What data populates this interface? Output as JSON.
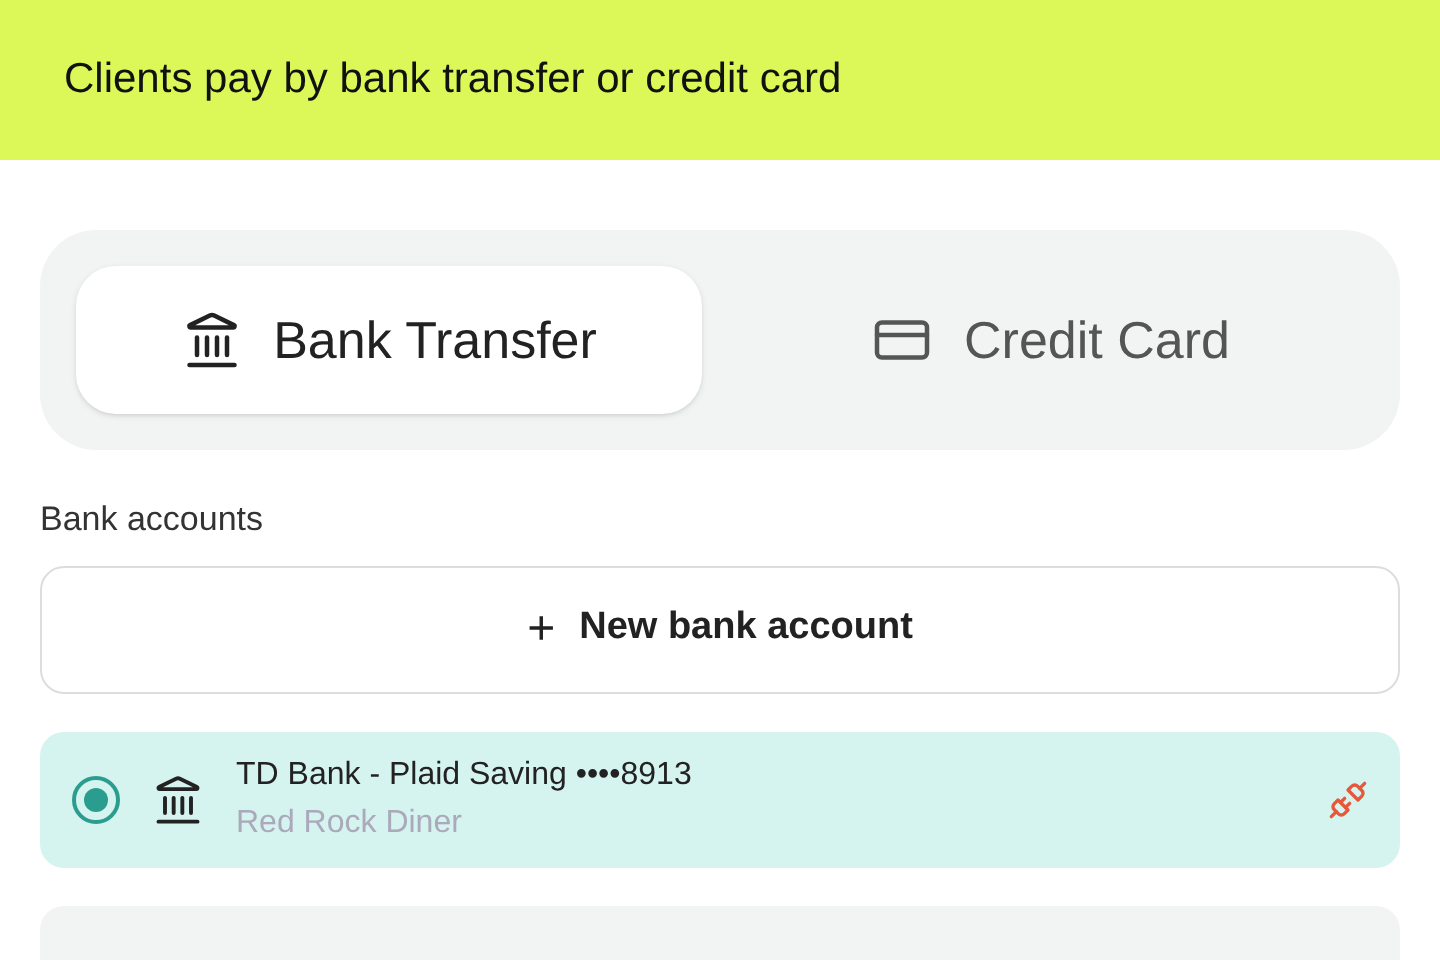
{
  "banner": {
    "title": "Clients pay by bank transfer or credit card"
  },
  "tabs": [
    {
      "label": "Bank Transfer",
      "kind": "bank",
      "selected": true
    },
    {
      "label": "Credit Card",
      "kind": "card",
      "selected": false
    }
  ],
  "section_label": "Bank accounts",
  "new_account_button": {
    "icon": "+",
    "label": "New bank account"
  },
  "accounts": [
    {
      "name": "TD Bank - Plaid Saving ••••8913",
      "owner": "Red Rock Diner",
      "selected": true,
      "disconnected": true
    }
  ]
}
